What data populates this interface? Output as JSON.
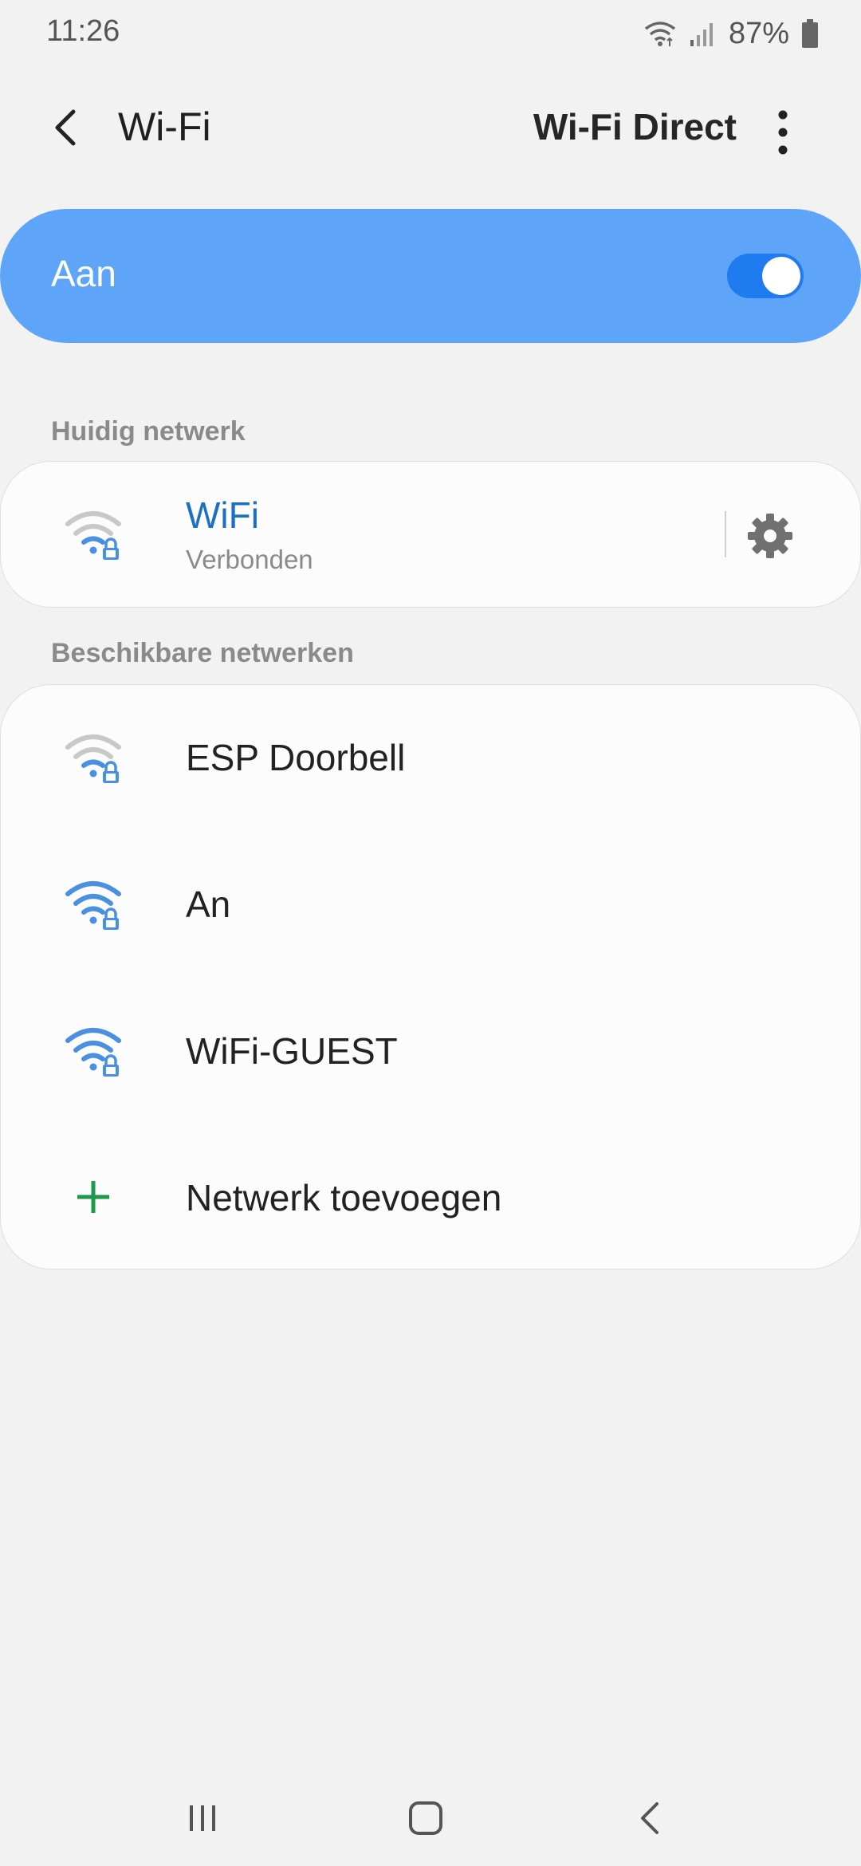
{
  "status_bar": {
    "time": "11:26",
    "battery": "87%",
    "icons": [
      "wifi-data-icon",
      "signal-icon",
      "battery-icon"
    ]
  },
  "app_bar": {
    "title": "Wi-Fi",
    "wifi_direct_label": "Wi-Fi Direct",
    "icons": [
      "back-arrow-icon",
      "more-vert-icon"
    ]
  },
  "master_switch": {
    "label": "Aan",
    "state_on": true
  },
  "current_network": {
    "section_label": "Huidig netwerk",
    "name": "WiFi",
    "status": "Verbonden",
    "icons": [
      "wifi-lock-icon",
      "gear-icon"
    ]
  },
  "available_networks": {
    "section_label": "Beschikbare netwerken",
    "items": [
      {
        "name": "ESP Doorbell",
        "icon": "wifi-lock-icon",
        "signal": "weak"
      },
      {
        "name": "An",
        "icon": "wifi-lock-icon",
        "signal": "strong"
      },
      {
        "name": "WiFi-GUEST",
        "icon": "wifi-lock-icon",
        "signal": "strong"
      }
    ],
    "add_network_label": "Netwerk toevoegen"
  },
  "colors": {
    "background": "#f2f2f2",
    "switch_bar": "#5ea5fa",
    "toggle": "#1e7bf0",
    "accent_blue": "#1b6fc7",
    "wifi_icon_blue": "#4a90e2",
    "add_green": "#1a9a4a"
  },
  "nav_bar": {
    "icons": [
      "recents-icon",
      "home-icon",
      "back-icon"
    ]
  }
}
